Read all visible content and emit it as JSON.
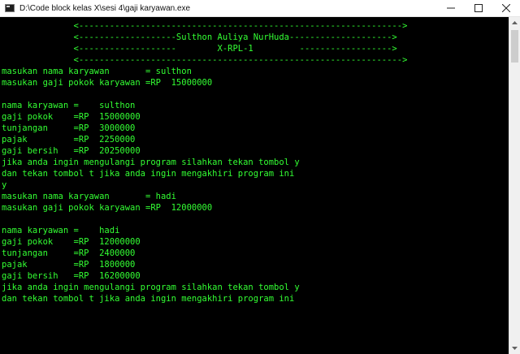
{
  "window": {
    "title": "D:\\Code block kelas X\\sesi 4\\gaji karyawan.exe",
    "controls": {
      "minimize": "—",
      "maximize": "☐",
      "close": "✕"
    }
  },
  "console": {
    "lines": [
      "              <--------------------------------------------------------------->",
      "              <-------------------Sulthon Auliya NurHuda-------------------->",
      "              <-------------------        X-RPL-1         ------------------>",
      "              <--------------------------------------------------------------->",
      "masukan nama karyawan       = sulthon",
      "masukan gaji pokok karyawan =RP  15000000",
      "",
      "nama karyawan =    sulthon",
      "gaji pokok    =RP  15000000",
      "tunjangan     =RP  3000000",
      "pajak         =RP  2250000",
      "gaji bersih   =RP  20250000",
      "jika anda ingin mengulangi program silahkan tekan tombol y",
      "dan tekan tombol t jika anda ingin mengakhiri program ini",
      "y",
      "masukan nama karyawan       = hadi",
      "masukan gaji pokok karyawan =RP  12000000",
      "",
      "nama karyawan =    hadi",
      "gaji pokok    =RP  12000000",
      "tunjangan     =RP  2400000",
      "pajak         =RP  1800000",
      "gaji bersih   =RP  16200000",
      "jika anda ingin mengulangi program silahkan tekan tombol y",
      "dan tekan tombol t jika anda ingin mengakhiri program ini"
    ]
  },
  "colors": {
    "console_background": "#000000",
    "console_text": "#33ff33",
    "titlebar_background": "#ffffff"
  }
}
